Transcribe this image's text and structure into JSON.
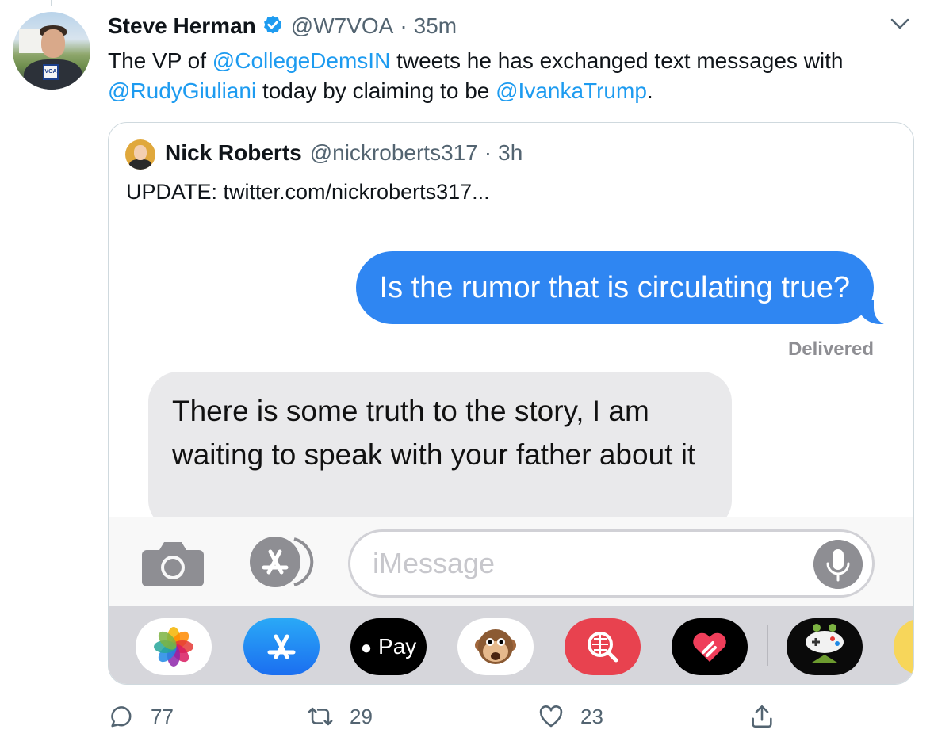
{
  "tweet": {
    "author_name": "Steve Herman",
    "author_handle": "@W7VOA",
    "separator": "·",
    "time": "35m",
    "text_parts": [
      {
        "type": "text",
        "value": "The VP of "
      },
      {
        "type": "mention",
        "value": "@CollegeDemsIN"
      },
      {
        "type": "text",
        "value": " tweets he has exchanged text messages with "
      },
      {
        "type": "mention",
        "value": "@RudyGiuliani"
      },
      {
        "type": "text",
        "value": " today by claiming to be "
      },
      {
        "type": "mention",
        "value": "@IvankaTrump"
      },
      {
        "type": "text",
        "value": "."
      }
    ],
    "avatar_badge": "VOA"
  },
  "quote": {
    "author_name": "Nick Roberts",
    "author_handle": "@nickroberts317",
    "separator": "·",
    "time": "3h",
    "text": "UPDATE:  twitter.com/nickroberts317..."
  },
  "imessage": {
    "outgoing": "Is the rumor that is circulating true?",
    "status": "Delivered",
    "incoming": "There is some truth to the story, I am waiting to speak with your father about it",
    "placeholder": "iMessage",
    "apple_pay_label": "Pay",
    "apps": [
      "photos-icon",
      "app-store-icon",
      "apple-pay-icon",
      "animoji-monkey-icon",
      "web-images-icon",
      "digital-touch-icon",
      "game-icon",
      "sticker-icon"
    ]
  },
  "actions": {
    "replies": "77",
    "retweets": "29",
    "likes": "23"
  },
  "colors": {
    "link": "#1d9bf0",
    "imessage_blue": "#2f86f2",
    "incoming_gray": "#e9e9eb",
    "muted": "#536471"
  }
}
